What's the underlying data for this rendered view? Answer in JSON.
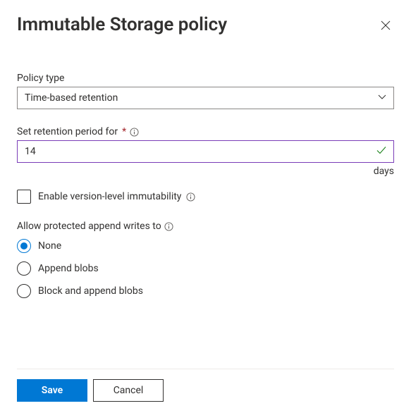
{
  "header": {
    "title": "Immutable Storage policy"
  },
  "policyType": {
    "label": "Policy type",
    "value": "Time-based retention"
  },
  "retention": {
    "label": "Set retention period for",
    "value": "14",
    "unit": "days"
  },
  "versionLevel": {
    "label": "Enable version-level immutability"
  },
  "appendWrites": {
    "label": "Allow protected append writes to",
    "options": {
      "none": "None",
      "append": "Append blobs",
      "blockAppend": "Block and append blobs"
    }
  },
  "footer": {
    "save": "Save",
    "cancel": "Cancel"
  }
}
